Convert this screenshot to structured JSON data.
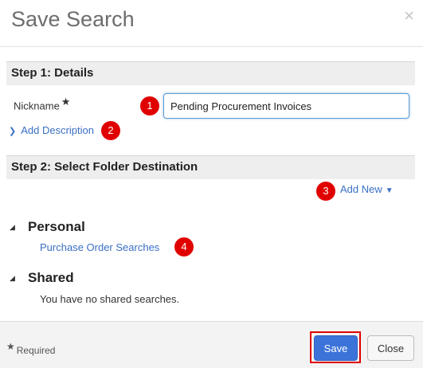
{
  "dialog": {
    "title": "Save Search",
    "close_glyph": "×"
  },
  "step1": {
    "header": "Step 1: Details",
    "nickname_label": "Nickname",
    "required_marker": "★",
    "nickname_value": "Pending Procurement Invoices",
    "add_description_link": "Add Description"
  },
  "step2": {
    "header": "Step 2: Select Folder Destination",
    "add_new_link": "Add New"
  },
  "folders": {
    "personal": {
      "title": "Personal",
      "items": [
        "Purchase Order Searches"
      ]
    },
    "shared": {
      "title": "Shared",
      "empty_message": "You have no shared searches."
    }
  },
  "annotations": [
    "1",
    "2",
    "3",
    "4"
  ],
  "footer": {
    "required_star": "★",
    "required_note": "Required",
    "save_label": "Save",
    "close_label": "Close"
  },
  "colors": {
    "accent": "#3b73d8",
    "link": "#3a6fc4",
    "annotation": "#e00000"
  }
}
